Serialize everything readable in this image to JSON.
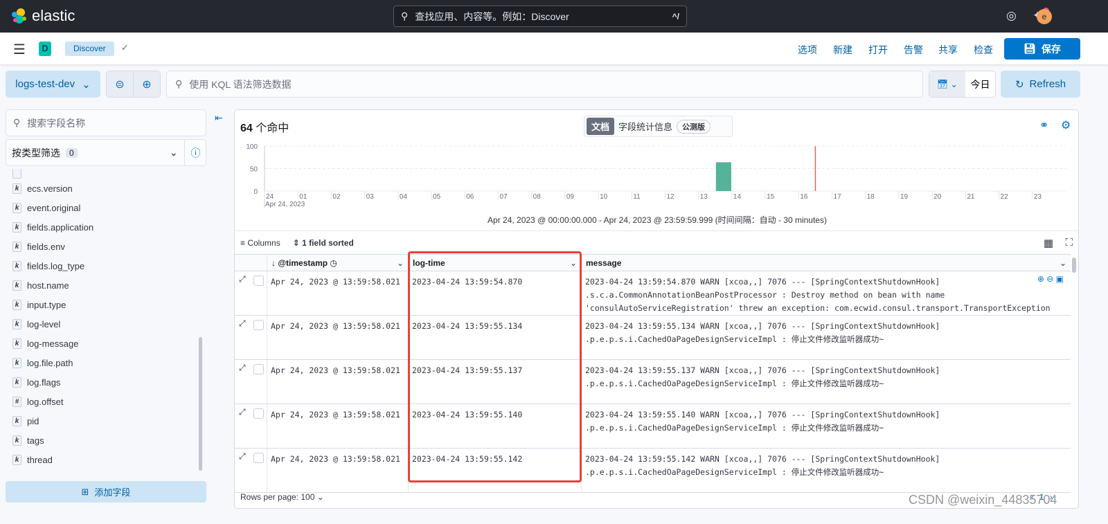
{
  "topbar": {
    "brand": "elastic",
    "search_placeholder": "查找应用、内容等。例如：Discover",
    "search_shortcut": "^/",
    "avatar_letter": "e"
  },
  "nav": {
    "space_letter": "D",
    "breadcrumb": "Discover",
    "links": [
      "选项",
      "新建",
      "打开",
      "告警",
      "共享",
      "检查"
    ],
    "save_label": "保存"
  },
  "query": {
    "data_view": "logs-test-dev",
    "kql_placeholder": "使用 KQL 语法筛选数据",
    "date_label": "今日",
    "refresh_label": "Refresh"
  },
  "sidebar": {
    "search_placeholder": "搜索字段名称",
    "type_filter_label": "按类型筛选",
    "type_filter_count": "0",
    "fields": [
      {
        "type": "k",
        "name": "ecs.version"
      },
      {
        "type": "k",
        "name": "event.original"
      },
      {
        "type": "k",
        "name": "fields.application"
      },
      {
        "type": "k",
        "name": "fields.env"
      },
      {
        "type": "k",
        "name": "fields.log_type"
      },
      {
        "type": "k",
        "name": "host.name"
      },
      {
        "type": "k",
        "name": "input.type"
      },
      {
        "type": "k",
        "name": "log-level"
      },
      {
        "type": "k",
        "name": "log-message"
      },
      {
        "type": "k",
        "name": "log.file.path"
      },
      {
        "type": "k",
        "name": "log.flags"
      },
      {
        "type": "#",
        "name": "log.offset"
      },
      {
        "type": "k",
        "name": "pid"
      },
      {
        "type": "k",
        "name": "tags"
      },
      {
        "type": "k",
        "name": "thread"
      }
    ],
    "add_field_label": "添加字段"
  },
  "main": {
    "hits_count": "64",
    "hits_label": "个命中",
    "tabs": [
      "文档",
      "字段统计信息"
    ],
    "beta_label": "公测版",
    "time_range": "Apr 24, 2023 @ 00:00:00.000 - Apr 24, 2023 @ 23:59:59.999  (时间间隔：自动 - 30 minutes)",
    "columns_label": "Columns",
    "sorted_label": "1 field sorted",
    "headers": [
      "@timestamp",
      "log-time",
      "message"
    ],
    "rows": [
      {
        "timestamp": "Apr 24, 2023 @ 13:59:58.021",
        "log_time": "2023-04-24 13:59:54.870",
        "message": "2023-04-24 13:59:54.870 WARN [xcoa,,] 7076 --- [SpringContextShutdownHook]\n.s.c.a.CommonAnnotationBeanPostProcessor : Destroy method on bean with name\n'consulAutoServiceRegistration' threw an exception: com.ecwid.consul.transport.TransportException"
      },
      {
        "timestamp": "Apr 24, 2023 @ 13:59:58.021",
        "log_time": "2023-04-24 13:59:55.134",
        "message": "2023-04-24 13:59:55.134 WARN [xcoa,,] 7076 --- [SpringContextShutdownHook]\n.p.e.p.s.i.CachedOaPageDesignServiceImpl : 停止文件修改监听器成功~"
      },
      {
        "timestamp": "Apr 24, 2023 @ 13:59:58.021",
        "log_time": "2023-04-24 13:59:55.137",
        "message": "2023-04-24 13:59:55.137 WARN [xcoa,,] 7076 --- [SpringContextShutdownHook]\n.p.e.p.s.i.CachedOaPageDesignServiceImpl : 停止文件修改监听器成功~"
      },
      {
        "timestamp": "Apr 24, 2023 @ 13:59:58.021",
        "log_time": "2023-04-24 13:59:55.140",
        "message": "2023-04-24 13:59:55.140 WARN [xcoa,,] 7076 --- [SpringContextShutdownHook]\n.p.e.p.s.i.CachedOaPageDesignServiceImpl : 停止文件修改监听器成功~"
      },
      {
        "timestamp": "Apr 24, 2023 @ 13:59:58.021",
        "log_time": "2023-04-24 13:59:55.142",
        "message": "2023-04-24 13:59:55.142 WARN [xcoa,,] 7076 --- [SpringContextShutdownHook]\n.p.e.p.s.i.CachedOaPageDesignServiceImpl : 停止文件修改监听器成功~"
      }
    ],
    "rows_per_page": "Rows per page: 100",
    "current_page": "1"
  },
  "chart_data": {
    "type": "bar",
    "x_unit": "hour",
    "x_ticks": [
      "24",
      "01",
      "02",
      "03",
      "04",
      "05",
      "06",
      "07",
      "08",
      "09",
      "10",
      "11",
      "12",
      "13",
      "14",
      "15",
      "16",
      "17",
      "18",
      "19",
      "20",
      "21",
      "22",
      "23"
    ],
    "x_sublabel": "Apr 24, 2023",
    "y_ticks": [
      "0",
      "50",
      "100"
    ],
    "ylim": [
      0,
      100
    ],
    "bars": [
      {
        "x": "13:30",
        "value": 64
      }
    ],
    "now_marker": "16:30",
    "bar_color": "#54b399",
    "marker_color": "#e7664c"
  },
  "watermark": "CSDN @weixin_44835704"
}
